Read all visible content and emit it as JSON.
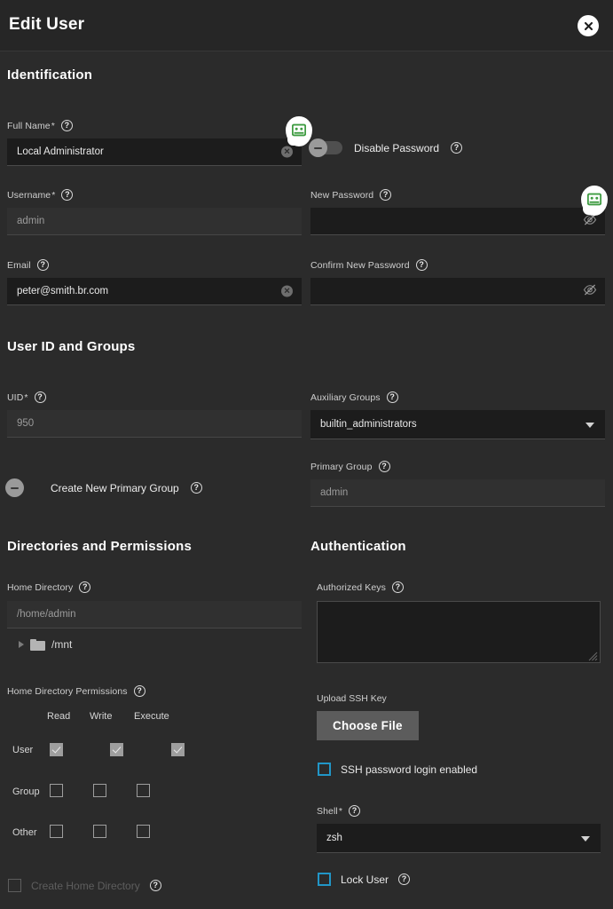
{
  "header": {
    "title": "Edit User",
    "close_icon": "close-icon"
  },
  "sections": {
    "identification": "Identification",
    "user_id_and_groups": "User ID and Groups",
    "directories_and_permissions": "Directories and Permissions",
    "authentication": "Authentication"
  },
  "fields": {
    "full_name": {
      "label": "Full Name",
      "required": "*",
      "value": "Local Administrator"
    },
    "username": {
      "label": "Username",
      "required": "*",
      "value": "admin"
    },
    "email": {
      "label": "Email",
      "value": "peter@smith.br.com"
    },
    "new_password": {
      "label": "New Password",
      "value": ""
    },
    "confirm_new_password": {
      "label": "Confirm New Password",
      "value": ""
    },
    "uid": {
      "label": "UID",
      "required": "*",
      "value": "950"
    },
    "auxiliary_groups": {
      "label": "Auxiliary Groups",
      "value": "builtin_administrators"
    },
    "primary_group": {
      "label": "Primary Group",
      "value": "admin"
    },
    "home_directory": {
      "label": "Home Directory",
      "value": "/home/admin"
    },
    "home_directory_permissions": {
      "label": "Home Directory Permissions"
    },
    "authorized_keys": {
      "label": "Authorized Keys",
      "value": ""
    },
    "shell": {
      "label": "Shell",
      "required": "*",
      "value": "zsh"
    }
  },
  "toggles": {
    "disable_password": {
      "label": "Disable Password",
      "state": "off"
    },
    "create_new_primary_group": {
      "label": "Create New Primary Group",
      "state": "off"
    }
  },
  "checkboxes": {
    "ssh_password_login": {
      "label": "SSH password login enabled",
      "checked": false
    },
    "lock_user": {
      "label": "Lock User",
      "checked": false
    },
    "create_home_directory": {
      "label": "Create Home Directory",
      "checked": false,
      "disabled": true
    }
  },
  "tree": {
    "items": [
      {
        "label": "/mnt",
        "expanded": false
      }
    ]
  },
  "permissions": {
    "columns": [
      "Read",
      "Write",
      "Execute"
    ],
    "rows": [
      {
        "label": "User",
        "values": [
          true,
          true,
          true
        ],
        "disabled": true
      },
      {
        "label": "Group",
        "values": [
          false,
          false,
          false
        ],
        "disabled": false
      },
      {
        "label": "Other",
        "values": [
          false,
          false,
          false
        ],
        "disabled": false
      }
    ]
  },
  "upload": {
    "label": "Upload SSH Key",
    "button": "Choose File"
  },
  "badges": {
    "bot_one": "bot-assistant-icon",
    "bot_two": "bot-assistant-icon"
  },
  "colors": {
    "page_bg": "#2b2b2b",
    "header_bg": "#262626",
    "input_bg": "#1c1c1c",
    "readonly_bg": "#303030",
    "accent_checkbox": "#2196c7",
    "bot_green": "#3f9c42",
    "button_grey": "#5c5c5c"
  },
  "help_icon": "help-icon"
}
